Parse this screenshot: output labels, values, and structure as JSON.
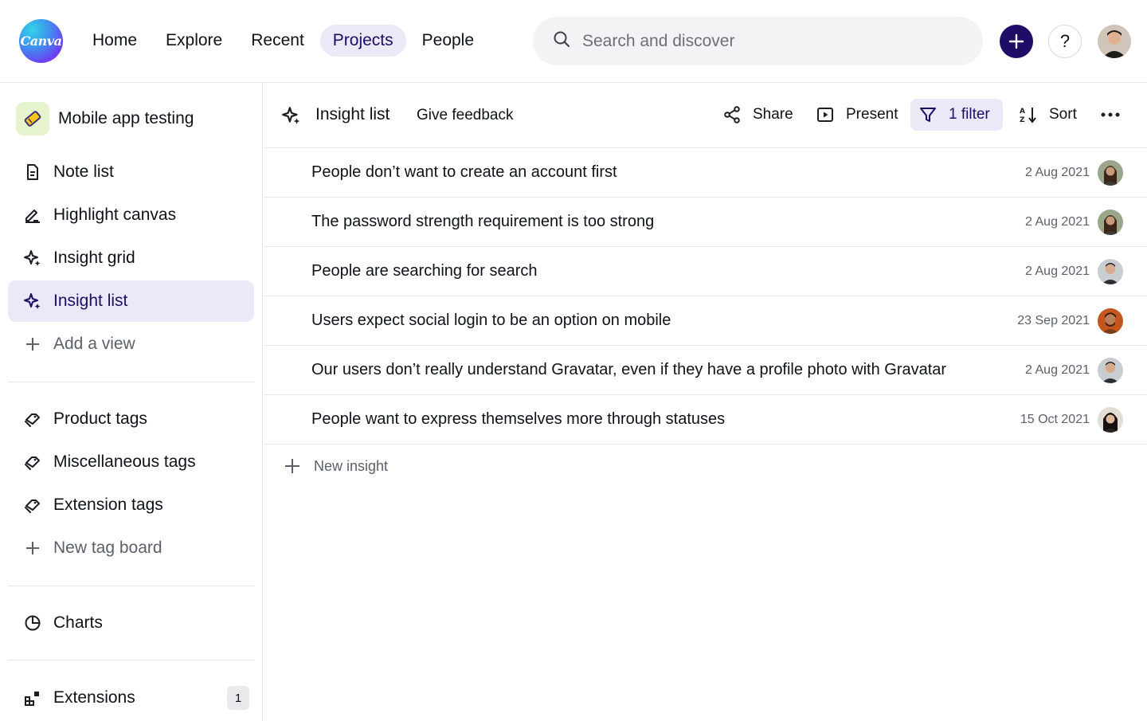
{
  "header": {
    "logo_text": "Canva",
    "nav": [
      {
        "label": "Home",
        "active": false
      },
      {
        "label": "Explore",
        "active": false
      },
      {
        "label": "Recent",
        "active": false
      },
      {
        "label": "Projects",
        "active": true
      },
      {
        "label": "People",
        "active": false
      }
    ],
    "search": {
      "placeholder": "Search and discover",
      "value": ""
    },
    "help_label": "?"
  },
  "sidebar": {
    "project_title": "Mobile app testing",
    "views": [
      {
        "label": "Note list",
        "icon": "note-icon",
        "active": false
      },
      {
        "label": "Highlight canvas",
        "icon": "highlight-icon",
        "active": false
      },
      {
        "label": "Insight grid",
        "icon": "sparkle-icon",
        "active": false
      },
      {
        "label": "Insight list",
        "icon": "sparkle-icon",
        "active": true
      },
      {
        "label": "Add a view",
        "icon": "plus-icon",
        "active": false
      }
    ],
    "tags": [
      {
        "label": "Product tags",
        "icon": "tag-icon"
      },
      {
        "label": "Miscellaneous tags",
        "icon": "tag-icon"
      },
      {
        "label": "Extension tags",
        "icon": "tag-icon"
      },
      {
        "label": "New tag board",
        "icon": "plus-icon"
      }
    ],
    "charts_label": "Charts",
    "extensions_label": "Extensions",
    "extensions_count": "1"
  },
  "toolbar": {
    "title": "Insight list",
    "feedback": "Give feedback",
    "share": "Share",
    "present": "Present",
    "filter": "1 filter",
    "sort": "Sort"
  },
  "insights": [
    {
      "title": "People don’t want to create an account first",
      "date": "2 Aug 2021"
    },
    {
      "title": "The password strength requirement is too strong",
      "date": "2 Aug 2021"
    },
    {
      "title": "People are searching for search",
      "date": "2 Aug 2021"
    },
    {
      "title": "Users expect social login to be an option on mobile",
      "date": "23 Sep 2021"
    },
    {
      "title": "Our users don’t really understand Gravatar, even if they have a profile photo with Gravatar",
      "date": "2 Aug 2021"
    },
    {
      "title": "People want to express themselves more through statuses",
      "date": "15 Oct 2021"
    }
  ],
  "new_insight_label": "New insight",
  "colors": {
    "accent": "#1f0c66",
    "active_bg": "#ebe9f7",
    "divider": "#e6e7ea"
  }
}
